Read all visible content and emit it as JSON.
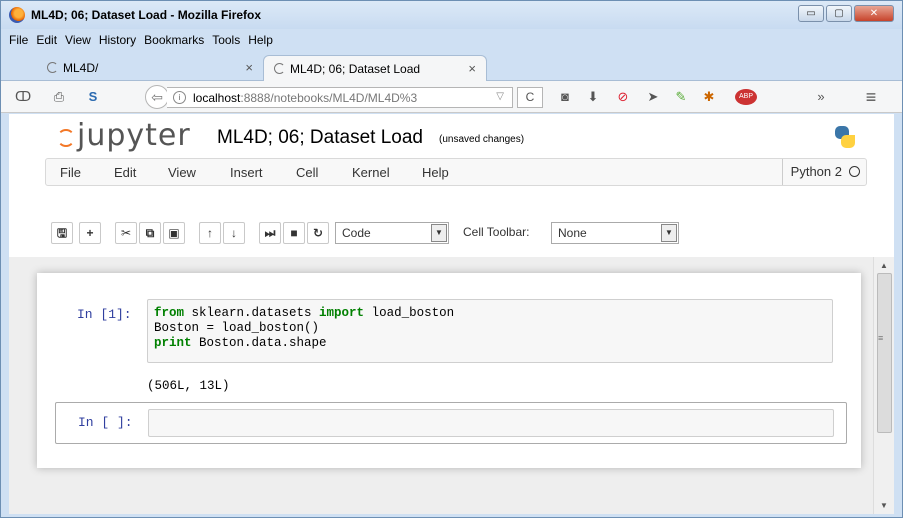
{
  "window": {
    "title": "ML4D; 06; Dataset Load - Mozilla Firefox",
    "minimize": "▭",
    "maximize": "▢",
    "close": "✕"
  },
  "menubar": [
    "File",
    "Edit",
    "View",
    "History",
    "Bookmarks",
    "Tools",
    "Help"
  ],
  "tabs": [
    {
      "label": "ML4D/",
      "close": "×",
      "active": false
    },
    {
      "label": "ML4D; 06; Dataset Load",
      "close": "×",
      "active": true
    }
  ],
  "navbar": {
    "url_host": "localhost",
    "url_rest": ":8888/notebooks/ML4D/ML4D%3",
    "url_dropdown": "▽",
    "reload": "C",
    "overflow": "»",
    "hamburger": "≡"
  },
  "jupyter": {
    "logo_text": "jupyter",
    "notebook_name": "ML4D; 06; Dataset Load",
    "save_status": "(unsaved changes)",
    "menu": [
      "File",
      "Edit",
      "View",
      "Insert",
      "Cell",
      "Kernel",
      "Help"
    ],
    "kernel_name": "Python 2",
    "cell_type": "Code",
    "cell_toolbar_label": "Cell Toolbar:",
    "cell_toolbar_value": "None"
  },
  "cells": [
    {
      "prompt": "In [1]:",
      "lines": [
        [
          {
            "t": "from",
            "kw": true
          },
          {
            "t": " sklearn.datasets ",
            "kw": false
          },
          {
            "t": "import",
            "kw": true
          },
          {
            "t": " load_boston",
            "kw": false
          }
        ],
        [
          {
            "t": "Boston = load_boston()",
            "kw": false
          }
        ],
        [
          {
            "t": "print",
            "kw": true
          },
          {
            "t": " Boston.data.shape",
            "kw": false
          }
        ]
      ],
      "output": "(506L, 13L)"
    },
    {
      "prompt": "In [ ]:",
      "lines": [],
      "output": ""
    }
  ]
}
